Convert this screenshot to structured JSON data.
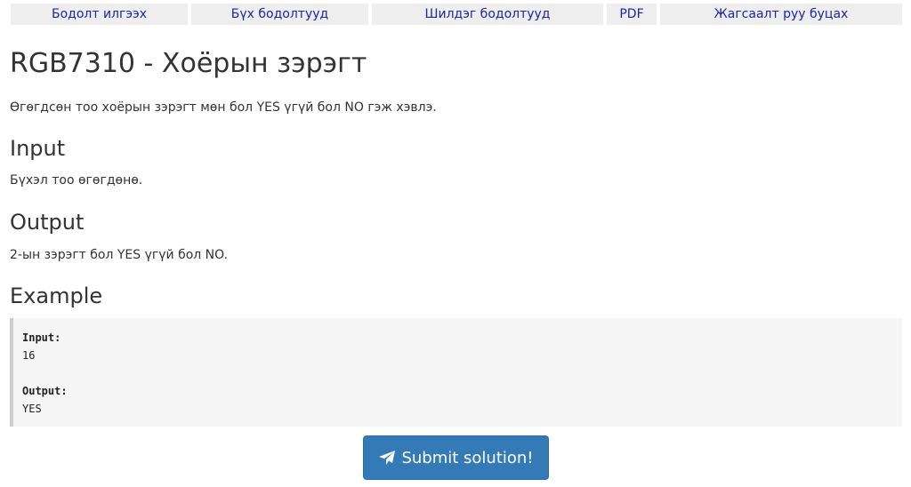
{
  "nav": {
    "items": [
      {
        "label": "Бодолт илгээх"
      },
      {
        "label": "Бүх бодолтууд"
      },
      {
        "label": "Шилдэг бодолтууд"
      },
      {
        "label": "PDF"
      },
      {
        "label": "Жагсаалт руу буцах"
      }
    ]
  },
  "problem": {
    "title": "RGB7310 - Хоёрын зэрэгт",
    "statement": "Өгөгдсөн тоо хоёрын зэрэгт мөн бол YES үгүй бол NO гэж хэвлэ.",
    "input_heading": "Input",
    "input_text": "Бүхэл тоо өгөгдөнө.",
    "output_heading": "Output",
    "output_text": "2-ын зэрэгт бол YES үгүй бол NO.",
    "example_heading": "Example",
    "example": {
      "input_label": "Input:",
      "input_value": "16",
      "output_label": "Output:",
      "output_value": "YES"
    }
  },
  "submit": {
    "label": "Submit solution!",
    "icon": "paper-plane-icon",
    "color": "#337ab7"
  }
}
